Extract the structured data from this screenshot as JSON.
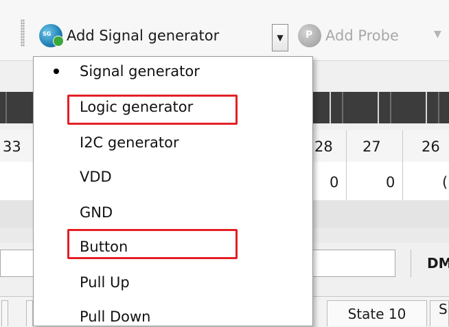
{
  "toolbar": {
    "add_signal_generator_label": "Add Signal generator",
    "add_signal_generator_icon_text": "SG",
    "add_probe_label": "Add Probe",
    "add_probe_icon_text": "P",
    "dropdown_arrow": "▼",
    "right_arrow": "▼"
  },
  "columns": {
    "headers": [
      "33",
      "28",
      "27",
      "26"
    ],
    "values": [
      "0",
      "0",
      "("
    ]
  },
  "labels": {
    "dm": "DM",
    "state10_tab": "State 10",
    "state_tab_partial": "S"
  },
  "menu": {
    "selected": "Signal generator",
    "items": [
      "Signal generator",
      "Logic generator",
      "I2C generator",
      "VDD",
      "GND",
      "Button",
      "Pull Up",
      "Pull Down"
    ],
    "highlighted": [
      "Logic generator",
      "Button"
    ]
  },
  "colors": {
    "highlight": "#e41e25",
    "menu_background": "#ffffff",
    "toolbar_background": "#f7f7f7"
  },
  "icons": {
    "signal_generator": "signal-generator-icon",
    "probe": "probe-icon",
    "bullet": "selected-bullet-icon"
  }
}
